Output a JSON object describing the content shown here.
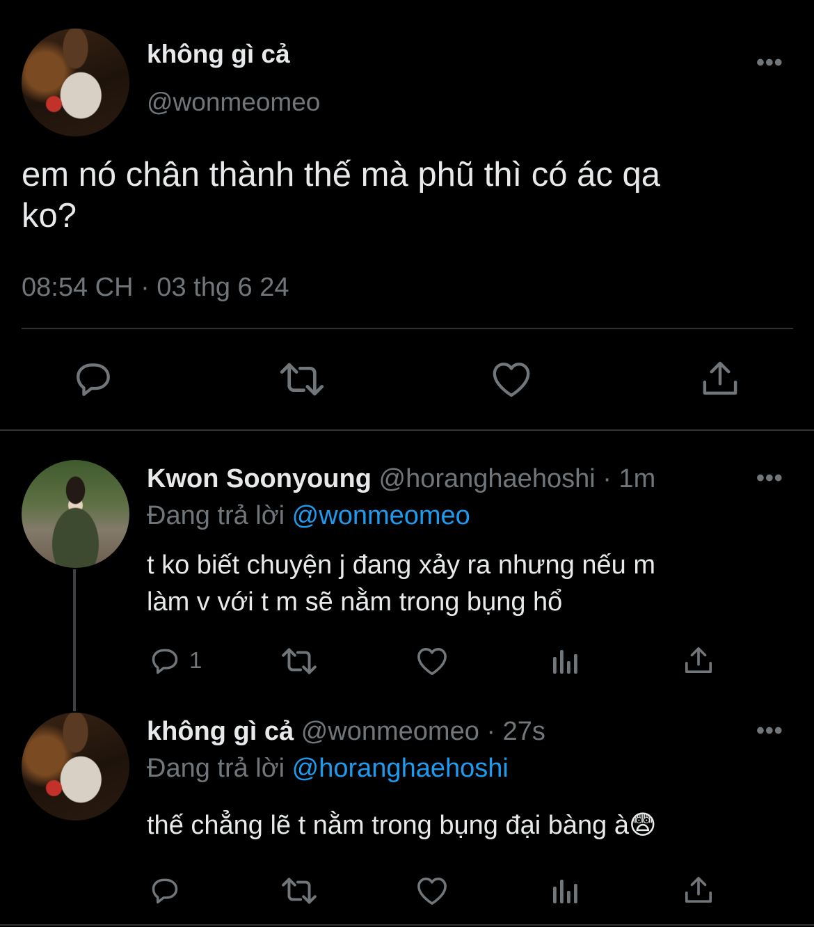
{
  "main_tweet": {
    "display_name": "không gì cả",
    "handle": "@wonmeomeo",
    "text_line1": "em nó chân thành thế mà phũ thì có ác qa",
    "text_line2": "ko?",
    "timestamp": "08:54 CH · 03 thg 6 24",
    "more": "•••"
  },
  "replies": [
    {
      "display_name": "Kwon Soonyoung",
      "handle": "@horanghaehoshi",
      "time": "· 1m",
      "replying_label": "Đang trả lời",
      "replying_to": "@wonmeomeo",
      "text_line1": "t ko biết chuyện j đang xảy ra nhưng nếu m",
      "text_line2": "làm v với t m sẽ nằm trong bụng hổ",
      "reply_count": "1",
      "more": "•••"
    },
    {
      "display_name": "không gì cả",
      "handle": "@wonmeomeo",
      "time": "· 27s",
      "replying_label": "Đang trả lời",
      "replying_to": "@horanghaehoshi",
      "text": "thế chẳng lẽ t nằm trong bụng đại bàng à",
      "emoji": "😨",
      "more": "•••"
    }
  ],
  "colors": {
    "accent": "#1d9bf0",
    "muted": "#71767b",
    "text": "#e7e9ea",
    "background": "#000000",
    "divider": "#2f3336"
  },
  "icons": [
    "reply-icon",
    "retweet-icon",
    "like-icon",
    "share-icon",
    "views-icon",
    "more-icon"
  ]
}
